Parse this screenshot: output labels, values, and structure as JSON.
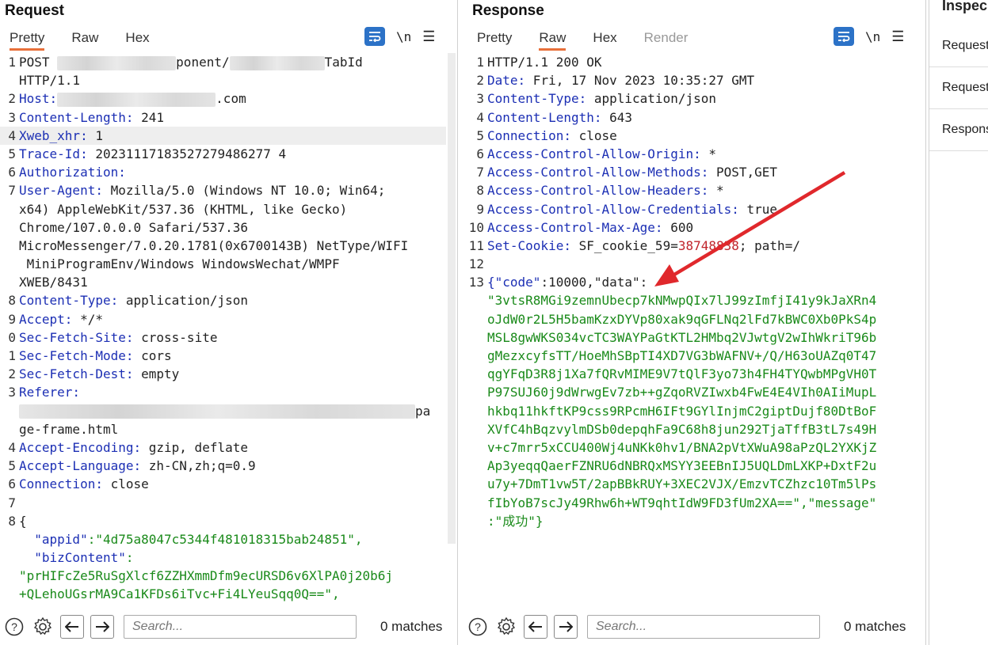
{
  "request": {
    "title": "Request",
    "tabs": [
      "Pretty",
      "Raw",
      "Hex"
    ],
    "active_tab": "Pretty",
    "toolbar": {
      "wrap_icon": "wrap-lines-icon",
      "newline_label": "\\n",
      "menu_icon": "hamburger-menu-icon"
    },
    "lines": [
      {
        "n": "1",
        "k": "POST ",
        "v": "ponent/",
        "tail": "TabId",
        "blur": true
      },
      {
        "n": "",
        "k": "",
        "v": "HTTP/1.1"
      },
      {
        "n": "2",
        "k": "Host:",
        "v": ".com",
        "blur": true
      },
      {
        "n": "3",
        "k": "Content-Length:",
        "v": " 241"
      },
      {
        "n": "4",
        "k": "Xweb_xhr:",
        "v": " 1",
        "hl": true
      },
      {
        "n": "5",
        "k": "Trace-Id:",
        "v": " 20231117183527279486277 4"
      },
      {
        "n": "6",
        "k": "Authorization:",
        "v": ""
      },
      {
        "n": "7",
        "k": "User-Agent:",
        "v": " Mozilla/5.0 (Windows NT 10.0; Win64;"
      },
      {
        "n": "",
        "k": "",
        "v": "x64) AppleWebKit/537.36 (KHTML, like Gecko)"
      },
      {
        "n": "",
        "k": "",
        "v": "Chrome/107.0.0.0 Safari/537.36"
      },
      {
        "n": "",
        "k": "",
        "v": "MicroMessenger/7.0.20.1781(0x6700143B) NetType/WIFI"
      },
      {
        "n": "",
        "k": "",
        "v": " MiniProgramEnv/Windows WindowsWechat/WMPF"
      },
      {
        "n": "",
        "k": "",
        "v": "XWEB/8431"
      },
      {
        "n": "8",
        "k": "Content-Type:",
        "v": " application/json"
      },
      {
        "n": "9",
        "k": "Accept:",
        "v": " */*"
      },
      {
        "n": "0",
        "k": "Sec-Fetch-Site:",
        "v": " cross-site"
      },
      {
        "n": "1",
        "k": "Sec-Fetch-Mode:",
        "v": " cors"
      },
      {
        "n": "2",
        "k": "Sec-Fetch-Dest:",
        "v": " empty"
      },
      {
        "n": "3",
        "k": "Referer:",
        "v": ""
      },
      {
        "n": "",
        "k": "",
        "v": "pa",
        "blur": true
      },
      {
        "n": "",
        "k": "",
        "v": "ge-frame.html"
      },
      {
        "n": "4",
        "k": "Accept-Encoding:",
        "v": " gzip, deflate"
      },
      {
        "n": "5",
        "k": "Accept-Language:",
        "v": " zh-CN,zh;q=0.9"
      },
      {
        "n": "6",
        "k": "Connection:",
        "v": " close"
      },
      {
        "n": "7",
        "k": "",
        "v": ""
      },
      {
        "n": "8",
        "k": "",
        "v": "{"
      },
      {
        "n": "",
        "k": "  \"appid\"",
        "v": ":\"4d75a8047c5344f481018315bab24851\",",
        "body": true
      },
      {
        "n": "",
        "k": "  \"bizContent\"",
        "v": ":",
        "body": true
      },
      {
        "n": "",
        "k": "",
        "v": "\"prHIFcZe5RuSgXlcf6ZZHXmmDfm9ecURSD6v6XlPA0j20b6j",
        "body": true
      },
      {
        "n": "",
        "k": "",
        "v": "+QLehoUGsrMA9Ca1KFDs6iTvc+Fi4LYeuSqq0Q==\",",
        "body": true
      }
    ],
    "search_placeholder": "Search...",
    "matches": "0 matches"
  },
  "response": {
    "title": "Response",
    "tabs": [
      "Pretty",
      "Raw",
      "Hex",
      "Render"
    ],
    "active_tab": "Raw",
    "toolbar": {
      "wrap_icon": "wrap-lines-icon",
      "newline_label": "\\n",
      "menu_icon": "hamburger-menu-icon"
    },
    "lines": [
      {
        "n": "1",
        "k": "",
        "v": "HTTP/1.1 200 OK"
      },
      {
        "n": "2",
        "k": "Date:",
        "v": " Fri, 17 Nov 2023 10:35:27 GMT"
      },
      {
        "n": "3",
        "k": "Content-Type:",
        "v": " application/json"
      },
      {
        "n": "4",
        "k": "Content-Length:",
        "v": " 643"
      },
      {
        "n": "5",
        "k": "Connection:",
        "v": " close"
      },
      {
        "n": "6",
        "k": "Access-Control-Allow-Origin:",
        "v": " *"
      },
      {
        "n": "7",
        "k": "Access-Control-Allow-Methods:",
        "v": " POST,GET"
      },
      {
        "n": "8",
        "k": "Access-Control-Allow-Headers:",
        "v": " *"
      },
      {
        "n": "9",
        "k": "Access-Control-Allow-Credentials:",
        "v": " true"
      },
      {
        "n": "10",
        "k": "Access-Control-Max-Age:",
        "v": " 600"
      },
      {
        "n": "11",
        "k": "Set-Cookie:",
        "v": " SF_cookie_59=",
        "red": "38748838",
        "tail": "; path=/"
      },
      {
        "n": "12",
        "k": "",
        "v": ""
      },
      {
        "n": "13",
        "k": "{\"code\"",
        "v": ":10000,\"data\":",
        "mixed": true
      },
      {
        "n": "",
        "k": "",
        "v": "\"3vtsR8MGi9zemnUbecp7kNMwpQIx7lJ99zImfjI41y9kJaXRn4",
        "body": true
      },
      {
        "n": "",
        "k": "",
        "v": "oJdW0r2L5H5bamKzxDYVp80xak9qGFLNq2lFd7kBWC0Xb0PkS4p",
        "body": true
      },
      {
        "n": "",
        "k": "",
        "v": "MSL8gwWKS034vcTC3WAYPaGtKTL2HMbq2VJwtgV2wIhWkriT96b",
        "body": true
      },
      {
        "n": "",
        "k": "",
        "v": "gMezxcyfsTT/HoeMhSBpTI4XD7VG3bWAFNV+/Q/H63oUAZq0T47",
        "body": true
      },
      {
        "n": "",
        "k": "",
        "v": "qgYFqD3R8j1Xa7fQRvMIME9V7tQlF3yo73h4FH4TYQwbMPgVH0T",
        "body": true
      },
      {
        "n": "",
        "k": "",
        "v": "P97SUJ60j9dWrwgEv7zb++gZqoRVZIwxb4FwE4E4VIh0AIiMupL",
        "body": true
      },
      {
        "n": "",
        "k": "",
        "v": "hkbq11hkftKP9css9RPcmH6IFt9GYlInjmC2giptDujf80DtBoF",
        "body": true
      },
      {
        "n": "",
        "k": "",
        "v": "XVfC4hBqzvylmDSb0depqhFa9C68h8jun292TjaTffB3tL7s49H",
        "body": true
      },
      {
        "n": "",
        "k": "",
        "v": "v+c7mrr5xCCU400Wj4uNKk0hv1/BNA2pVtXWuA98aPzQL2YXKjZ",
        "body": true
      },
      {
        "n": "",
        "k": "",
        "v": "Ap3yeqqQaerFZNRU6dNBRQxMSYY3EEBnIJ5UQLDmLXKP+DxtF2u",
        "body": true
      },
      {
        "n": "",
        "k": "",
        "v": "u7y+7DmT1vw5T/2apBBkRUY+3XEC2VJX/EmzvTCZhzc10Tm5lPs",
        "body": true
      },
      {
        "n": "",
        "k": "",
        "v": "fIbYoB7scJy49Rhw6h+WT9qhtIdW9FD3fUm2XA==\",\"message\"",
        "body": true
      },
      {
        "n": "",
        "k": "",
        "v": ":\"成功\"}",
        "body": true
      }
    ],
    "search_placeholder": "Search...",
    "matches": "0 matches"
  },
  "inspector": {
    "title": "Inspec",
    "items": [
      "Request",
      "Request",
      "Respons"
    ]
  },
  "colors": {
    "accent": "#e8703a",
    "header_key": "#1c2fb4",
    "body_string": "#1a8a1a",
    "cookie_value": "#c0242b",
    "arrow": "#e0282c"
  }
}
